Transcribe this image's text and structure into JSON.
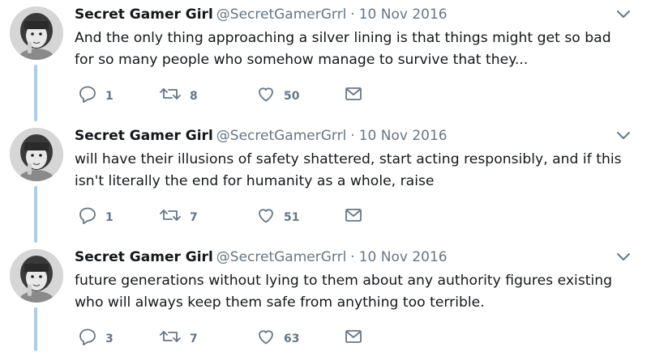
{
  "tweets": [
    {
      "name": "Secret Gamer Girl",
      "handle": "@SecretGamerGrrl",
      "separator": "·",
      "date": "10 Nov 2016",
      "text": "And the only thing approaching a silver lining is that things might get so bad for so many people who somehow manage to survive that they...",
      "replies": "1",
      "retweets": "8",
      "likes": "50"
    },
    {
      "name": "Secret Gamer Girl",
      "handle": "@SecretGamerGrrl",
      "separator": "·",
      "date": "10 Nov 2016",
      "text": "will have their illusions of safety shattered, start acting responsibly, and if this isn't literally the end for humanity as a whole, raise",
      "replies": "1",
      "retweets": "7",
      "likes": "51"
    },
    {
      "name": "Secret Gamer Girl",
      "handle": "@SecretGamerGrrl",
      "separator": "·",
      "date": "10 Nov 2016",
      "text": "future generations without lying to them about any authority figures existing who will always keep them safe from anything too terrible.",
      "replies": "3",
      "retweets": "7",
      "likes": "63"
    }
  ],
  "icons": {
    "reply": "reply-icon",
    "retweet": "retweet-icon",
    "like": "heart-icon",
    "dm": "envelope-icon",
    "caret": "chevron-down-icon",
    "avatar": "profile-photo"
  },
  "colors": {
    "text": "#14171a",
    "secondary": "#657786",
    "thread_line": "#a9cfe9"
  }
}
